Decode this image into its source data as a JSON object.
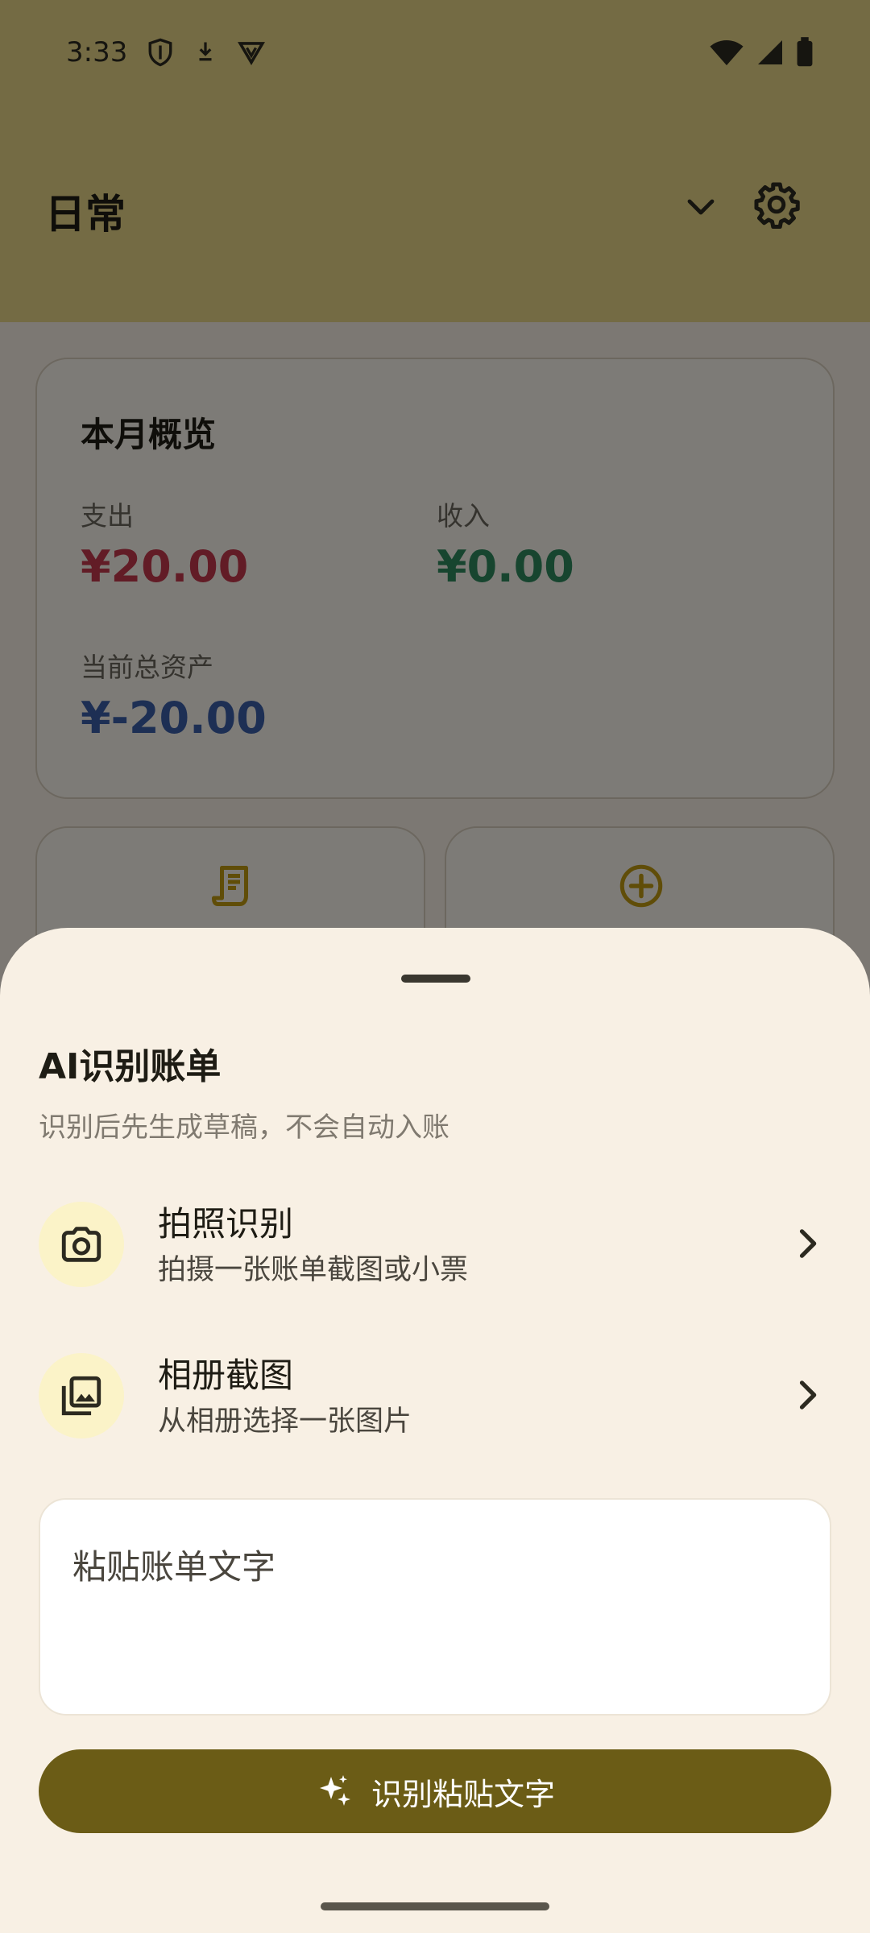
{
  "status_bar": {
    "time": "3:33",
    "icons_left": [
      "shield-icon",
      "download-icon",
      "vpn-icon"
    ],
    "icons_right": [
      "wifi-icon",
      "signal-icon",
      "battery-icon"
    ]
  },
  "header": {
    "ledger_name": "日常",
    "dropdown_icon": "chevron-down-icon",
    "settings_icon": "gear-icon"
  },
  "overview": {
    "title": "本月概览",
    "expense_label": "支出",
    "expense_value": "¥20.00",
    "income_label": "收入",
    "income_value": "¥0.00",
    "assets_label": "当前总资产",
    "assets_value": "¥-20.00"
  },
  "quick_actions": [
    {
      "icon": "receipt-icon"
    },
    {
      "icon": "add-circle-icon"
    }
  ],
  "sheet": {
    "title": "AI识别账单",
    "subtitle": "识别后先生成草稿，不会自动入账",
    "options": [
      {
        "title": "拍照识别",
        "desc": "拍摄一张账单截图或小票",
        "icon": "camera-icon"
      },
      {
        "title": "相册截图",
        "desc": "从相册选择一张图片",
        "icon": "gallery-icon"
      }
    ],
    "paste_placeholder": "粘贴账单文字",
    "recognize_button": "识别粘贴文字"
  },
  "colors": {
    "expense": "#c5394c",
    "income": "#2e8a5e",
    "assets": "#3a5ea8",
    "accent": "#6b5c16",
    "header_bg": "#e8d689"
  }
}
